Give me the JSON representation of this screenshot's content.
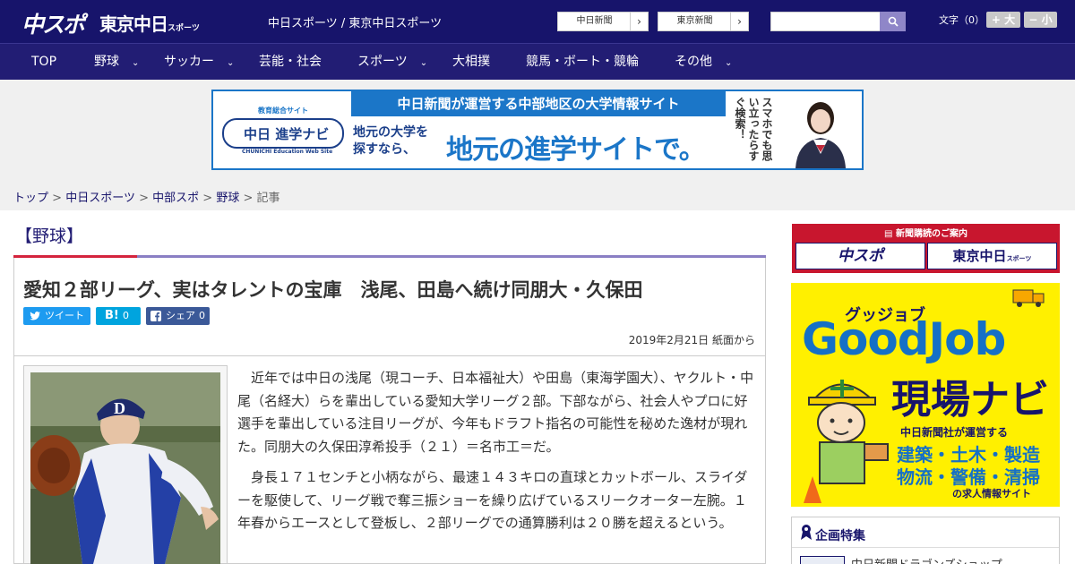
{
  "header": {
    "logo_chuspo": "中スポ",
    "logo_tokyo": "東京中日",
    "logo_tokyo_sub": "スポーツ",
    "site_title": "中日スポーツ / 東京中日スポーツ",
    "ext_links": [
      {
        "label": "中日新聞",
        "chevron": "›"
      },
      {
        "label": "東京新聞",
        "chevron": "›"
      }
    ],
    "search": {
      "placeholder": "",
      "value": "",
      "icon": "search-icon"
    },
    "font_size": {
      "label": "文字（0）",
      "increase": "+ 大",
      "decrease": "− 小"
    }
  },
  "nav": {
    "items": [
      {
        "label": "TOP",
        "dropdown": false
      },
      {
        "label": "野球",
        "dropdown": true
      },
      {
        "label": "サッカー",
        "dropdown": true
      },
      {
        "label": "芸能・社会",
        "dropdown": false
      },
      {
        "label": "スポーツ",
        "dropdown": true
      },
      {
        "label": "大相撲",
        "dropdown": false
      },
      {
        "label": "競馬・ボート・競輪",
        "dropdown": false
      },
      {
        "label": "その他",
        "dropdown": true
      }
    ],
    "chevron": "⌄"
  },
  "banner": {
    "sub": "教育総合サイト",
    "logo": "中日 進学ナビ",
    "logo_en": "CHUNICHI Education Web Site",
    "top_text": "中日新聞が運営する中部地区の大学情報サイト",
    "question_line1": "地元の大学を",
    "question_line2": "探すなら、",
    "main_text": "地元の進学サイトで。",
    "vertical_text": "スマホでも思い立ったらすぐ検索！"
  },
  "breadcrumb": {
    "items": [
      "トップ",
      "中日スポーツ",
      "中部スポ",
      "野球"
    ],
    "current": "記事",
    "separator": ">"
  },
  "article": {
    "section": "【野球】",
    "headline": "愛知２部リーグ、実はタレントの宝庫　浅尾、田島へ続け同朋大・久保田",
    "share": {
      "tweet": "ツイート",
      "hatena_label": "B!",
      "hatena_count": "0",
      "facebook_label": "シェア",
      "facebook_count": "0"
    },
    "dateline": "2019年2月21日 紙面から",
    "paragraphs": [
      "近年では中日の浅尾（現コーチ、日本福祉大）や田島（東海学園大）、ヤクルト・中尾（名経大）らを輩出している愛知大学リーグ２部。下部ながら、社会人やプロに好選手を輩出している注目リーグが、今年もドラフト指名の可能性を秘めた逸材が現れた。同朋大の久保田淳希投手（２１）＝名市工＝だ。",
      "身長１７１センチと小柄ながら、最速１４３キロの直球とカットボール、スライダーを駆使して、リーグ戦で奪三振ショーを繰り広げているスリークオーター左腕。１年春からエースとして登板し、２部リーグでの通算勝利は２０勝を超えるという。"
    ]
  },
  "sidebar": {
    "paper_ad": {
      "title": "新聞購読のご案内",
      "left": "中スポ",
      "right": "東京中日",
      "right_sub": "スポーツ"
    },
    "goodjob": {
      "kana": "グッジョブ",
      "title": "GoodJob",
      "navi": "現場ナビ",
      "desc": "中日新聞社が運営する",
      "list1": "建築・土木・製造",
      "list2": "物流・警備・清掃",
      "foot": "の求人情報サイト"
    },
    "feature": {
      "title": "企画特集",
      "item": "中日新聞ドラゴンズショップ"
    }
  },
  "colors": {
    "header_bg": "#17146b",
    "nav_bg": "#221d74",
    "accent_red": "#d4243d",
    "accent_purple": "#8a7fc4",
    "twitter": "#1d9bf0",
    "hatena": "#00a4de",
    "facebook": "#3b5998",
    "goodjob_yellow": "#fff000"
  }
}
